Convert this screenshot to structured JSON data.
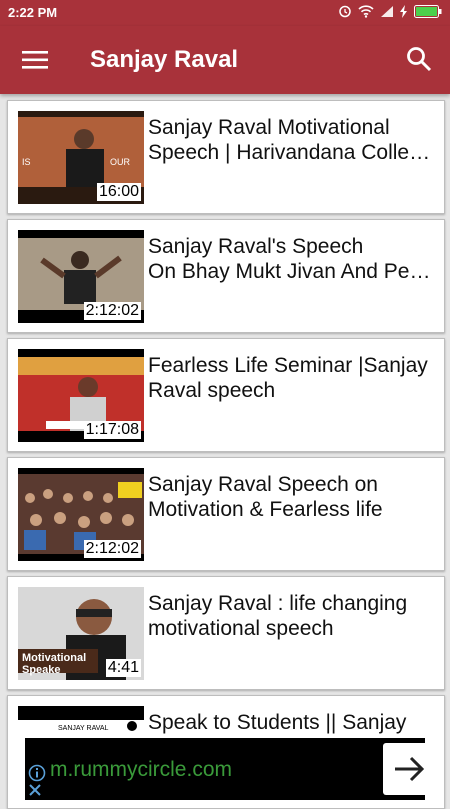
{
  "status_bar": {
    "time": "2:22 PM"
  },
  "app_bar": {
    "title": "Sanjay Raval"
  },
  "videos": [
    {
      "title_line1": "Sanjay Raval Motivational",
      "title_line2": "Speech | Harivandana Colle…",
      "duration": "16:00",
      "thumb_color": "#9a4a2a"
    },
    {
      "title_line1": "Sanjay Raval's Speech",
      "title_line2": "On Bhay Mukt Jivan And Pe…",
      "duration": "2:12:02",
      "thumb_color": "#8a7a6a"
    },
    {
      "title_line1": "Fearless Life Seminar |Sanjay",
      "title_line2": "Raval speech",
      "duration": "1:17:08",
      "thumb_color": "#b8302a"
    },
    {
      "title_line1": "Sanjay Raval Speech on",
      "title_line2": "Motivation & Fearless life",
      "duration": "2:12:02",
      "thumb_color": "#6a4a3a"
    },
    {
      "title_line1": "Sanjay Raval : life changing",
      "title_line2": "motivational speech",
      "duration": "4:41",
      "thumb_color": "#c8c8c8"
    },
    {
      "title_line1": "Speak to Students || Sanjay",
      "title_line2": "",
      "duration": "",
      "thumb_color": "#ffffff"
    }
  ],
  "ad": {
    "url_text": "m.rummycircle.com"
  }
}
